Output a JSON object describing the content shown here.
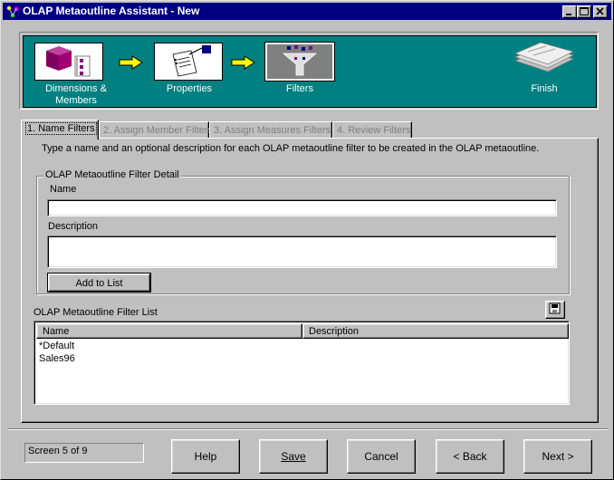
{
  "window": {
    "title": "OLAP Metaoutline Assistant - New",
    "controls": [
      "minimize-icon",
      "maximize-icon",
      "close-icon"
    ]
  },
  "steps": [
    {
      "label": "Dimensions &\nMembers",
      "icon": "cube-members-icon",
      "state": "done"
    },
    {
      "label": "Properties",
      "icon": "properties-form-icon",
      "state": "done"
    },
    {
      "label": "Filters",
      "icon": "funnel-filter-icon",
      "state": "active"
    },
    {
      "label": "Finish",
      "icon": "stacked-pages-icon",
      "state": "pending"
    }
  ],
  "tabs": [
    {
      "label": "1. Name Filters",
      "active": true
    },
    {
      "label": "2. Assign Member Filters",
      "active": false
    },
    {
      "label": "3. Assign Measures Filters",
      "active": false
    },
    {
      "label": "4. Review Filters",
      "active": false
    }
  ],
  "instructions": "Type a name and an optional description for each OLAP metaoutline filter to be created in the OLAP metaoutline.",
  "detail": {
    "group_title": "OLAP Metaoutline Filter Detail",
    "name_label": "Name",
    "name_value": "",
    "description_label": "Description",
    "description_value": "",
    "add_button_label": "Add to List"
  },
  "filter_list": {
    "title": "OLAP Metaoutline Filter List",
    "columns": [
      "Name",
      "Description"
    ],
    "rows": [
      {
        "name": "*Default",
        "description": ""
      },
      {
        "name": "Sales96",
        "description": ""
      }
    ]
  },
  "status": "Screen 5 of 9",
  "buttons": {
    "help": "Help",
    "save": "Save",
    "cancel": "Cancel",
    "back": "< Back",
    "next": "Next >"
  },
  "colors": {
    "title_bar": "#000080",
    "banner": "#008080",
    "face": "#c0c0c0",
    "arrow": "#ffff00"
  }
}
